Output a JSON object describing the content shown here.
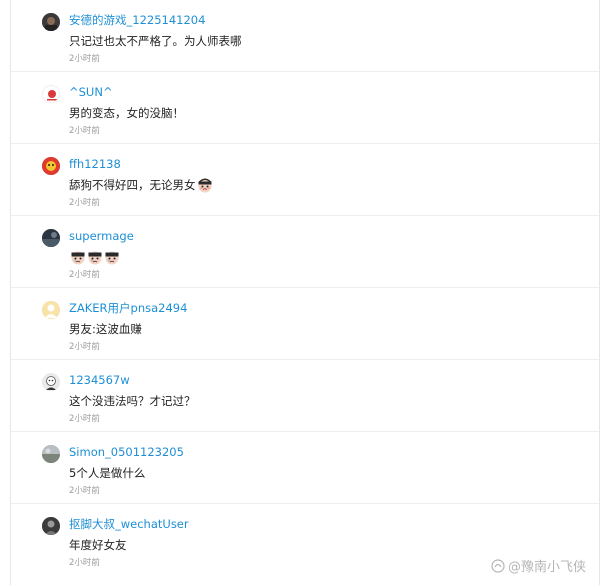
{
  "comments": [
    {
      "username": "安德的游戏_1225141204",
      "content": "只记过也太不严格了。为人师表哪",
      "time": "2小时前",
      "avatar_icon": "photo-dark-avatar",
      "emoji_count": 0
    },
    {
      "username": "^SUN^",
      "content": "男的变态，女的没脑！",
      "time": "2小时前",
      "avatar_icon": "red-logo-avatar",
      "emoji_count": 0
    },
    {
      "username": "ffh12138",
      "content": "舔狗不得好四，无论男女",
      "time": "2小时前",
      "avatar_icon": "red-yellow-avatar",
      "emoji_count": 1
    },
    {
      "username": "supermage",
      "content": "",
      "time": "2小时前",
      "avatar_icon": "dark-photo-avatar",
      "emoji_count": 3
    },
    {
      "username": "ZAKER用户pnsa2494",
      "content": "男友:这波血赚",
      "time": "2小时前",
      "avatar_icon": "yellow-default-avatar",
      "emoji_count": 0
    },
    {
      "username": "1234567w",
      "content": "这个没违法吗？才记过？",
      "time": "2小时前",
      "avatar_icon": "cartoon-avatar",
      "emoji_count": 0
    },
    {
      "username": "Simon_0501123205",
      "content": "5个人是做什么",
      "time": "2小时前",
      "avatar_icon": "landscape-avatar",
      "emoji_count": 0
    },
    {
      "username": "抠脚大叔_wechatUser",
      "content": "年度好女友",
      "time": "2小时前",
      "avatar_icon": "dark-person-avatar",
      "emoji_count": 0
    }
  ],
  "watermark": {
    "text": "@豫南小飞侠"
  },
  "colors": {
    "username": "#1d8fd6",
    "content": "#222222",
    "time": "#9a9a9a",
    "divider": "#eeeeee"
  }
}
